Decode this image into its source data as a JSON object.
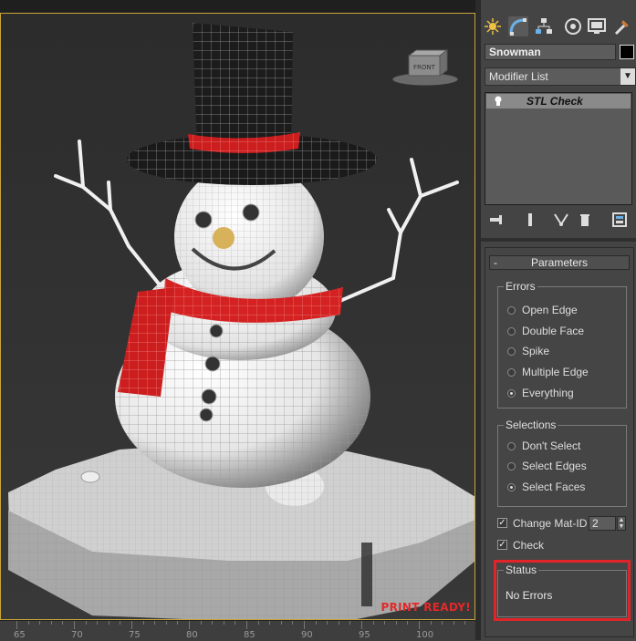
{
  "viewport": {
    "badge": "PRINT READY!",
    "viewcube_label": "FRONT",
    "colors": {
      "border": "#c9a53a",
      "scarf": "#d42222",
      "badge": "#e22a2a"
    }
  },
  "ruler": {
    "ticks": [
      "65",
      "70",
      "75",
      "80",
      "85",
      "90",
      "95",
      "100"
    ]
  },
  "command_panel": {
    "tabs": [
      "create-icon",
      "modify-icon",
      "hierarchy-icon",
      "motion-icon",
      "display-icon",
      "utilities-icon"
    ],
    "object_name": "Snowman",
    "modifier_list": "Modifier List",
    "stack": {
      "items": [
        "STL Check"
      ]
    },
    "stack_tools": [
      "pin-stack-icon",
      "show-end-result-icon",
      "make-unique-icon",
      "remove-modifier-icon",
      "configure-modifier-sets-icon"
    ]
  },
  "parameters": {
    "header": "Parameters",
    "collapse": "-",
    "errors": {
      "title": "Errors",
      "options": [
        "Open Edge",
        "Double Face",
        "Spike",
        "Multiple Edge",
        "Everything"
      ],
      "selected": "Everything"
    },
    "selections": {
      "title": "Selections",
      "options": [
        "Don't Select",
        "Select Edges",
        "Select Faces"
      ],
      "selected": "Select Faces"
    },
    "change_mat_id": {
      "label": "Change Mat-ID",
      "checked": true,
      "value": "2"
    },
    "check": {
      "label": "Check",
      "checked": true
    },
    "status": {
      "title": "Status",
      "text": "No Errors"
    },
    "highlight_color": "#e0242a"
  }
}
